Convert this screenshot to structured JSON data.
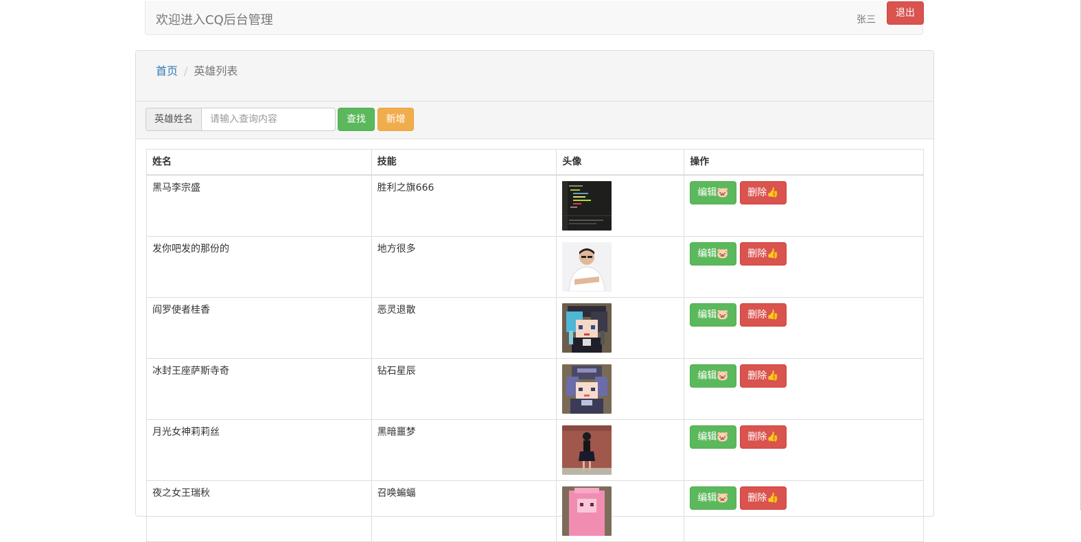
{
  "header": {
    "brand": "欢迎进入CQ后台管理",
    "user": "张三",
    "logout_label": "退出"
  },
  "breadcrumb": {
    "home": "首页",
    "separator": "/",
    "current": "英雄列表"
  },
  "search": {
    "addon_label": "英雄姓名",
    "placeholder": "请输入查询内容",
    "value": "",
    "search_label": "查找",
    "add_label": "新增"
  },
  "table": {
    "headers": [
      "姓名",
      "技能",
      "头像",
      "操作"
    ],
    "rows": [
      {
        "name": "黑马李宗盛",
        "skill": "胜利之旗666",
        "avatar": "code-screenshot-avatar",
        "edit": "编辑🐷",
        "delete": "删除👍"
      },
      {
        "name": "发你吧发的那份的",
        "skill": "地方很多",
        "avatar": "man-portrait-avatar",
        "edit": "编辑🐷",
        "delete": "删除👍"
      },
      {
        "name": "阎罗使者桂香",
        "skill": "恶灵退散",
        "avatar": "pixel-girl-blue-hair-avatar",
        "edit": "编辑🐷",
        "delete": "删除👍"
      },
      {
        "name": "冰封王座萨斯寺奇",
        "skill": "钻石星辰",
        "avatar": "pixel-girl-purple-hat-avatar",
        "edit": "编辑🐷",
        "delete": "删除👍"
      },
      {
        "name": "月光女神莉莉丝",
        "skill": "黑暗噩梦",
        "avatar": "woman-photo-avatar",
        "edit": "编辑🐷",
        "delete": "删除👍"
      },
      {
        "name": "夜之女王瑞秋",
        "skill": "召唤蝙蝠",
        "avatar": "pixel-pink-character-avatar",
        "edit": "编辑🐷",
        "delete": "删除👍"
      }
    ]
  },
  "colors": {
    "danger": "#d9534f",
    "success": "#5cb85c",
    "warning": "#f0ad4e",
    "link": "#337ab7"
  }
}
